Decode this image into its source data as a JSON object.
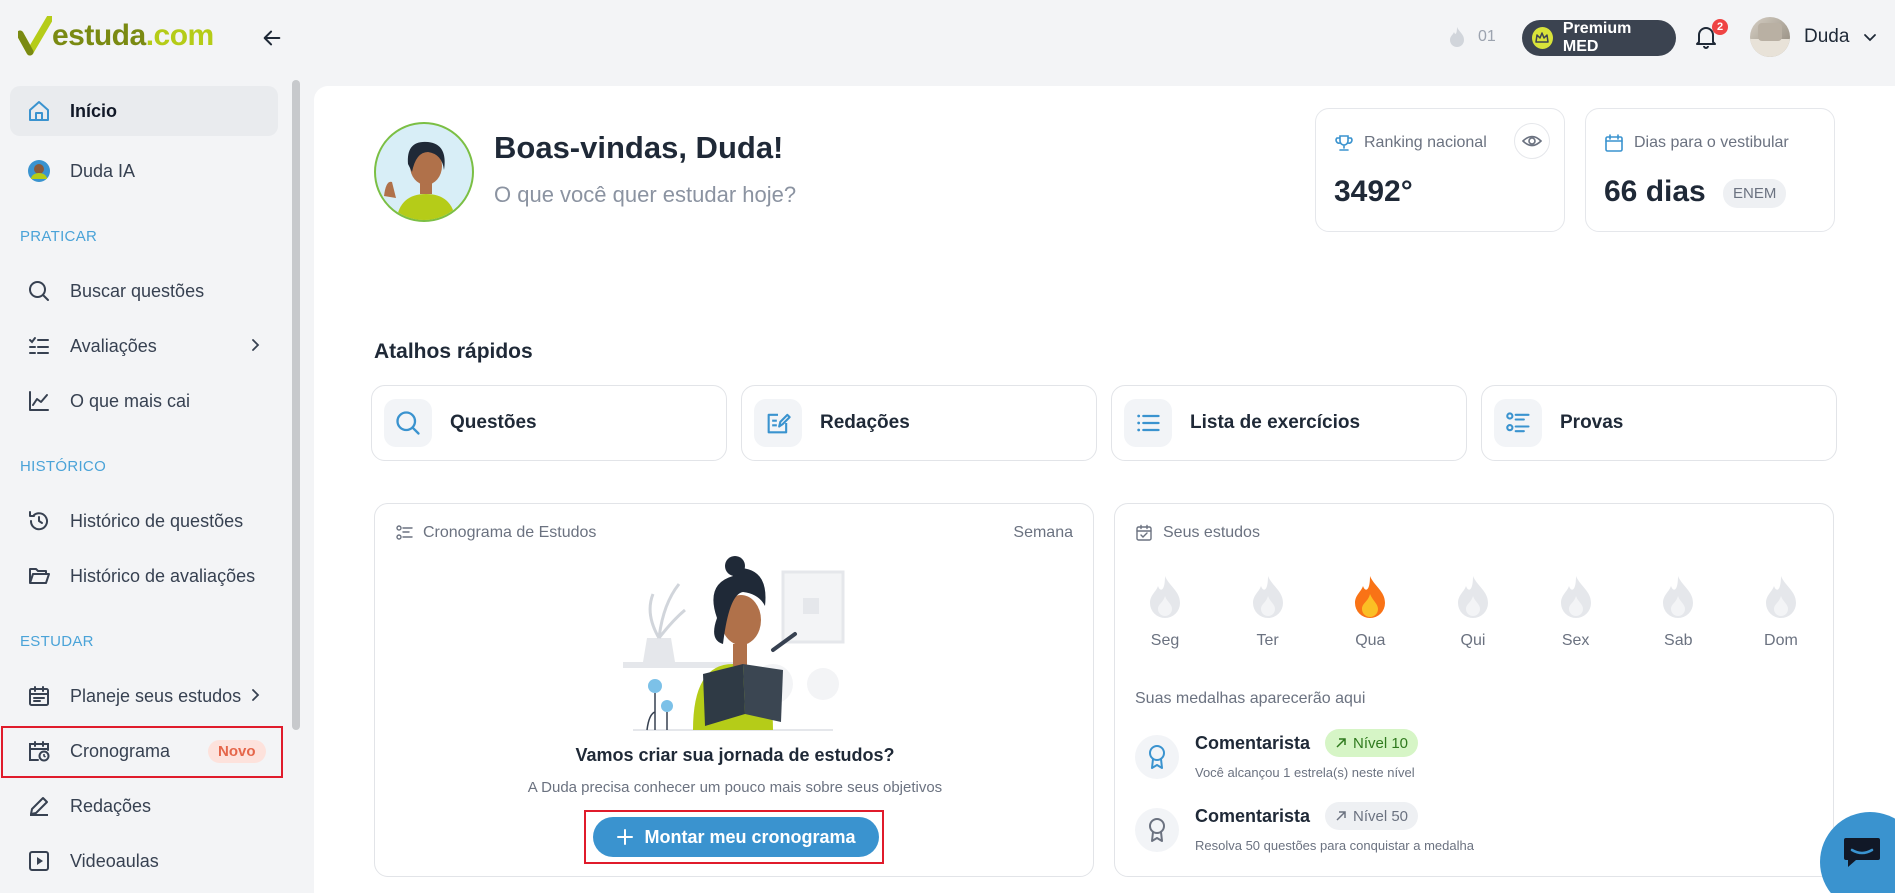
{
  "header": {
    "logo_main": "estuda",
    "logo_suffix": ".com",
    "streak_count": "01",
    "premium_label": "Premium MED",
    "notification_count": "2",
    "user_name": "Duda"
  },
  "sidebar": {
    "items": [
      {
        "label": "Início"
      },
      {
        "label": "Duda IA"
      },
      {
        "label": "Buscar questões"
      },
      {
        "label": "Avaliações"
      },
      {
        "label": "O que mais cai"
      },
      {
        "label": "Histórico de questões"
      },
      {
        "label": "Histórico de avaliações"
      },
      {
        "label": "Planeje seus estudos"
      },
      {
        "label": "Cronograma",
        "badge": "Novo"
      },
      {
        "label": "Redações"
      },
      {
        "label": "Videoaulas"
      }
    ],
    "sections": [
      "PRATICAR",
      "HISTÓRICO",
      "ESTUDAR"
    ]
  },
  "welcome": {
    "title": "Boas-vindas, Duda!",
    "subtitle": "O que você quer estudar hoje?"
  },
  "stats": {
    "ranking": {
      "label": "Ranking nacional",
      "value": "3492°"
    },
    "days": {
      "label": "Dias para o vestibular",
      "value": "66 dias",
      "tag": "ENEM"
    }
  },
  "shortcuts": {
    "title": "Atalhos rápidos",
    "items": [
      {
        "label": "Questões"
      },
      {
        "label": "Redações"
      },
      {
        "label": "Lista de exercícios"
      },
      {
        "label": "Provas"
      }
    ]
  },
  "schedule": {
    "title": "Cronograma de Estudos",
    "period": "Semana",
    "heading": "Vamos criar sua jornada de estudos?",
    "description": "A Duda precisa conhecer um pouco mais sobre seus objetivos",
    "cta": "Montar meu cronograma"
  },
  "studies": {
    "title": "Seus estudos",
    "days": [
      "Seg",
      "Ter",
      "Qua",
      "Qui",
      "Sex",
      "Sab",
      "Dom"
    ],
    "active_day": "Qua",
    "medals_label": "Suas medalhas aparecerão aqui",
    "medals": [
      {
        "name": "Comentarista",
        "level": "Nível 10",
        "desc": "Você alcançou 1 estrela(s) neste nível"
      },
      {
        "name": "Comentarista",
        "level": "Nível 50",
        "desc": "Resolva 50 questões para conquistar a medalha"
      }
    ]
  },
  "colors": {
    "accent": "#3a93cf",
    "highlight": "#e01b2b",
    "section": "#4aa3d8",
    "badge_bg": "#fde2dc",
    "badge_text": "#e5664a",
    "level_active_bg": "#d6f5c6"
  }
}
